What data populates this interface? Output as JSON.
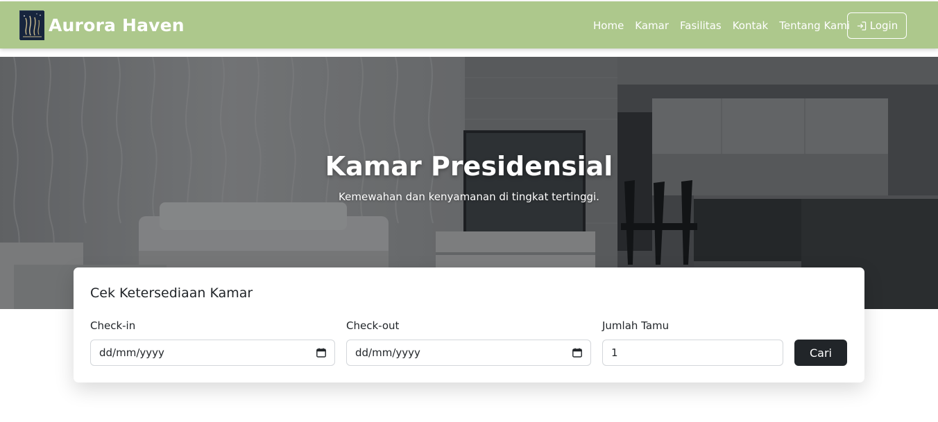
{
  "navbar": {
    "brand": "Aurora Haven",
    "links": [
      "Home",
      "Kamar",
      "Fasilitas",
      "Kontak",
      "Tentang Kami"
    ],
    "login_label": "Login"
  },
  "hero": {
    "title": "Kamar Presidensial",
    "subtitle": "Kemewahan dan kenyamanan di tingkat tertinggi."
  },
  "availability": {
    "title": "Cek Ketersediaan Kamar",
    "checkin": {
      "label": "Check-in",
      "placeholder": "dd/mm/yyyy"
    },
    "checkout": {
      "label": "Check-out",
      "placeholder": "dd/mm/yyyy"
    },
    "guests": {
      "label": "Jumlah Tamu",
      "value": "1"
    },
    "search_label": "Cari"
  },
  "colors": {
    "navbar_bg": "#adc88c",
    "search_button_bg": "#212529",
    "logo_bg": "#17253d"
  },
  "icons": {
    "brand": "aurora-logo-icon",
    "login": "login-arrow-icon",
    "date": "calendar-icon"
  }
}
